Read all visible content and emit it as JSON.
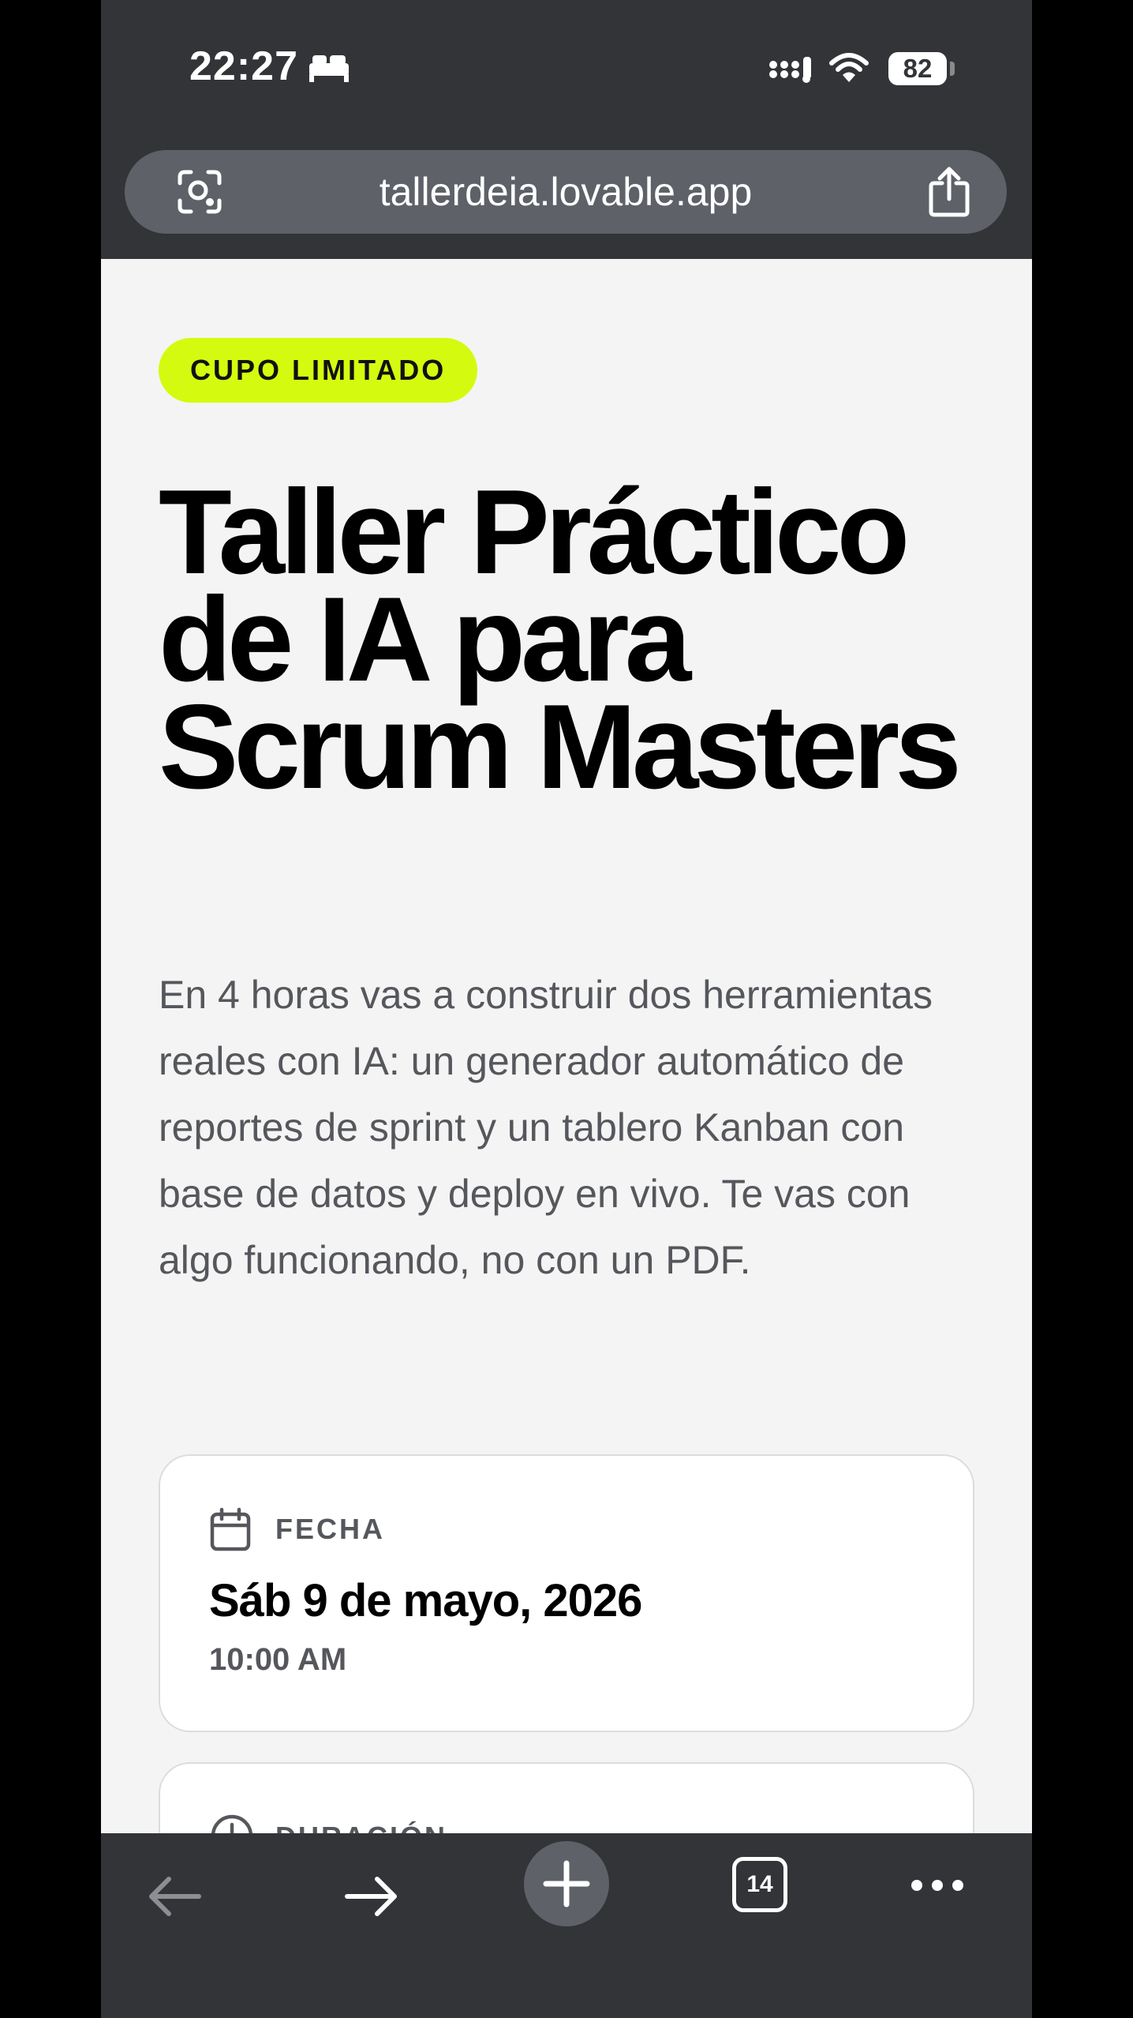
{
  "status_bar": {
    "time": "22:27",
    "battery": "82",
    "icons": [
      "bed-icon",
      "signal-icon",
      "wifi-icon",
      "battery-icon"
    ]
  },
  "browser": {
    "url": "tallerdeia.lovable.app",
    "tab_count": "14",
    "icons": [
      "lens-icon",
      "share-icon",
      "back-arrow-icon",
      "forward-arrow-icon",
      "plus-icon",
      "more-icon"
    ]
  },
  "hero": {
    "badge": "CUPO LIMITADO",
    "title": "Taller Práctico de IA para Scrum Masters",
    "intro": "En 4 horas vas a construir dos herramientas reales con IA: un generador automático de reportes de sprint y un tablero Kanban con base de datos y deploy en vivo. Te vas con algo funcionando, no con un PDF."
  },
  "cards": {
    "date": {
      "label": "FECHA",
      "value": "Sáb 9 de mayo, 2026",
      "time": "10:00 AM",
      "icon": "calendar-icon"
    },
    "duration": {
      "label": "DURACIÓN",
      "icon": "clock-icon"
    }
  },
  "colors": {
    "badge": "#d4fb0f",
    "chrome": "#323437",
    "background": "#f4f4f4"
  }
}
